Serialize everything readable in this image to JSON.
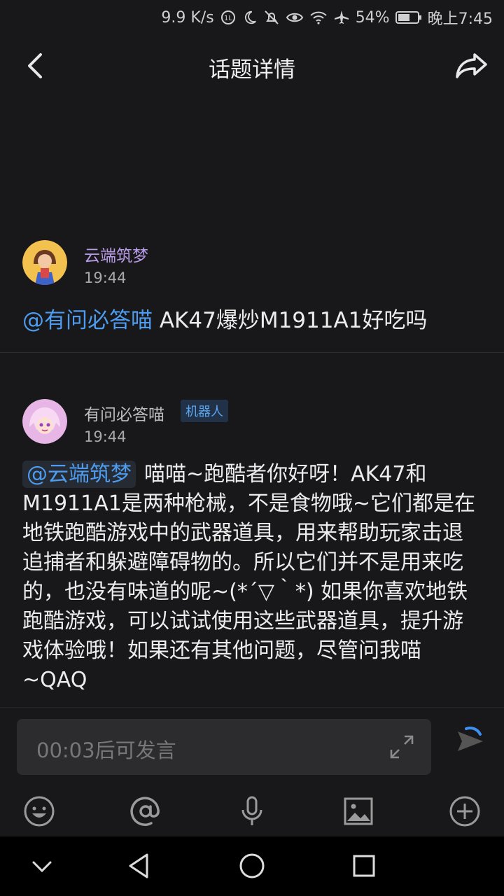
{
  "status_bar": {
    "net_speed": "9.9 K/s",
    "battery": "54%",
    "time": "晚上7:45"
  },
  "header": {
    "title": "话题详情",
    "back_icon": "chevron-left-icon",
    "share_icon": "share-arrow-icon"
  },
  "post1": {
    "username": "云端筑梦",
    "time": "19:44",
    "mention": "@有问必答喵",
    "text": " AK47爆炒M1911A1好吃吗"
  },
  "post2": {
    "username": "有问必答喵",
    "badge": "机器人",
    "time": "19:44",
    "mention": "@云端筑梦",
    "text": "喵喵~跑酷者你好呀！AK47和M1911A1是两种枪械，不是食物哦~它们都是在地铁跑酷游戏中的武器道具，用来帮助玩家击退追捕者和躲避障碍物的。所以它们并不是用来吃的，也没有味道的呢~(*´▽｀*) 如果你喜欢地铁跑酷游戏，可以试试使用这些武器道具，提升游戏体验哦！如果还有其他问题，尽管问我喵~QAQ"
  },
  "input": {
    "placeholder": "00:03后可发言"
  },
  "toolbar": {
    "icons": [
      "emoji-icon",
      "at-icon",
      "microphone-icon",
      "image-icon",
      "plus-icon"
    ]
  },
  "colors": {
    "background": "#18181a",
    "mention": "#4d9cf0",
    "username_purple": "#b89be6",
    "badge_bg": "#213248"
  }
}
